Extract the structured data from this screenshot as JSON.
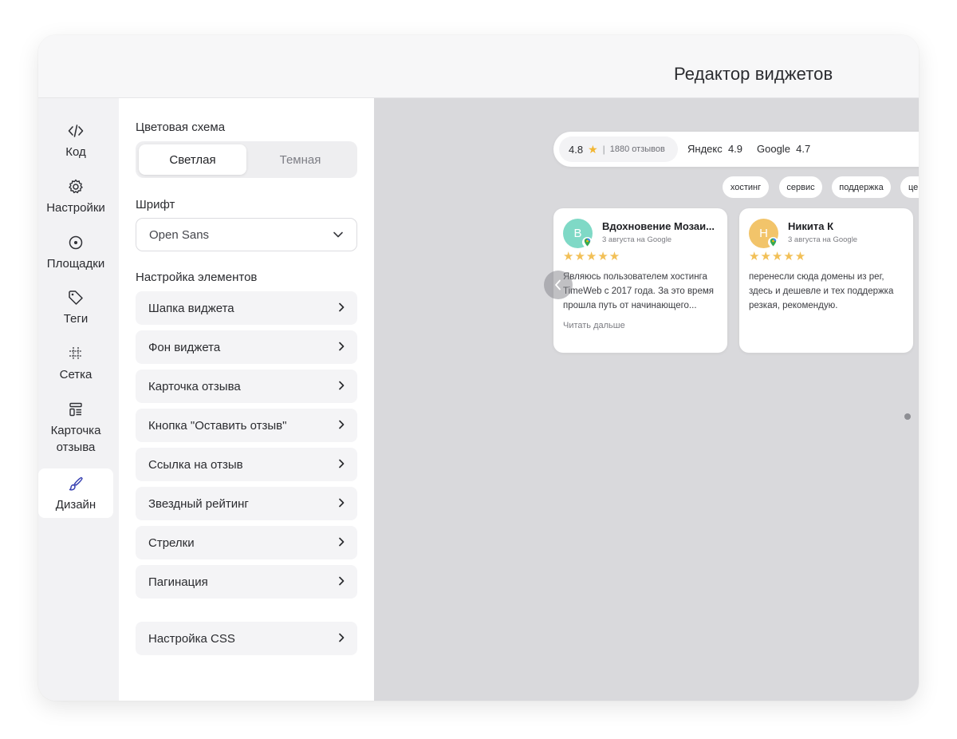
{
  "window": {
    "title": "Редактор виджетов"
  },
  "rail": {
    "items": [
      {
        "label": "Код",
        "icon": "code-icon"
      },
      {
        "label": "Настройки",
        "icon": "gear-icon"
      },
      {
        "label": "Площадки",
        "icon": "location-pin-icon"
      },
      {
        "label": "Теги",
        "icon": "tag-icon"
      },
      {
        "label": "Сетка",
        "icon": "grid-icon"
      },
      {
        "label": "Карточка отзыва",
        "icon": "card-layout-icon"
      },
      {
        "label": "Дизайн",
        "icon": "brush-icon",
        "active": true
      }
    ]
  },
  "settings": {
    "color_scheme": {
      "label": "Цветовая схема",
      "options": [
        "Светлая",
        "Темная"
      ],
      "selected": "Светлая"
    },
    "font": {
      "label": "Шрифт",
      "value": "Open Sans"
    },
    "elements": {
      "label": "Настройка элементов",
      "items": [
        "Шапка виджета",
        "Фон виджета",
        "Карточка отзыва",
        "Кнопка \"Оставить отзыв\"",
        "Ссылка на отзыв",
        "Звездный рейтинг",
        "Стрелки",
        "Пагинация"
      ]
    },
    "css": {
      "label": "Настройка CSS"
    }
  },
  "preview": {
    "rating": {
      "value": "4.8",
      "separator": "|",
      "count": "1880 отзывов"
    },
    "sources": [
      {
        "name": "Яндекс",
        "rating": "4.9"
      },
      {
        "name": "Google",
        "rating": "4.7"
      }
    ],
    "tags": [
      "хостинг",
      "сервис",
      "поддержка",
      "це"
    ],
    "reviews": [
      {
        "initial": "В",
        "avatar_color": "#7fd9c6",
        "name": "Вдохновение Мозаи...",
        "date": "3 августа на Google",
        "stars": "★★★★★",
        "text": "Являюсь пользователем хостинга TimeWeb с 2017 года. За это время прошла путь от начинающего...",
        "more": "Читать дальше"
      },
      {
        "initial": "Н",
        "avatar_color": "#f2c46a",
        "name": "Никита К",
        "date": "3 августа на Google",
        "stars": "★★★★★",
        "text": "перенесли сюда домены из рег, здесь и дешевле и тех поддержка резкая, рекомендую."
      }
    ]
  }
}
